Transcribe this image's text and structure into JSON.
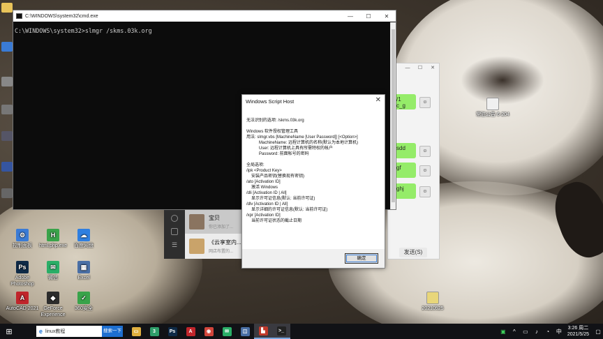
{
  "cmd": {
    "title": "C:\\WINDOWS\\system32\\cmd.exe",
    "line": "C:\\WINDOWS\\system32>slmgr /skms.03k.org",
    "minimize": "—",
    "maximize": "☐",
    "close": "✕"
  },
  "dialog": {
    "title": "Windows Script Host",
    "close": "✕",
    "lines": [
      "无法识别的选项: /skms.03k.org",
      "Windows 软件授权管理工具",
      "用法: slmgr.vbs [MachineName [User Password]] [<Option>]",
      "MachineName: 远程计算机的名称(默认为本地计算机)",
      "User: 远程计算机上具有所需特权的帐户",
      "Password: 前面帐号的密码",
      "全局选项:",
      "/ipk <Product Key>",
      "安装产品密钥(替换现有密钥)",
      "/ato [Activation ID]",
      "激活 Windows",
      "/dli [Activation ID | All]",
      "显示许可证信息(默认: 当前许可证)",
      "/dlv [Activation ID | All]",
      "显示详细的许可证信息(默认: 当前许可证)",
      "/xpr [Activation ID]",
      "当前许可证状态的截止日期"
    ],
    "ok_label": "确定"
  },
  "chat": {
    "minimize": "—",
    "maximize": "☐",
    "close": "✕",
    "bubbles": [
      "/1\nc_g",
      "sdd",
      "gf",
      "ghj"
    ],
    "send_label": "发送(S)"
  },
  "wechat_list": [
    {
      "name": "宝贝",
      "preview": "你已添加了..."
    },
    {
      "name": "《云享室内...",
      "preview": "网店布置的..."
    }
  ],
  "desktop_icons": [
    {
      "label": "控制面板",
      "color": "#3a7bd5",
      "glyph": "⚙"
    },
    {
      "label": "html.php.exe",
      "color": "#3aa34a",
      "glyph": "H"
    },
    {
      "label": "百度网盘",
      "color": "#2f7fe0",
      "glyph": "☁"
    },
    {
      "label": "Adobe Photoshop",
      "color": "#0e2a47",
      "glyph": "Ps"
    },
    {
      "label": "微信",
      "color": "#2aae67",
      "glyph": "✉"
    },
    {
      "label": "Excel",
      "color": "#4a6fa5",
      "glyph": "▦"
    },
    {
      "label": "AutoCAD 2021",
      "color": "#c0252b",
      "glyph": "A"
    },
    {
      "label": "GeForce Experience",
      "color": "#2c2c2c",
      "glyph": "◆"
    },
    {
      "label": "360安全",
      "color": "#39a34a",
      "glyph": "✓"
    }
  ],
  "right_icons": [
    {
      "label": "常驻公告 6-204",
      "color": "#f0f0f0"
    },
    {
      "label": "20210525",
      "color": "#e8d67a"
    }
  ],
  "taskbar": {
    "start": "⊞",
    "search_text": "linux教程",
    "search_button": "搜索一下",
    "apps": [
      {
        "glyph": "▭",
        "color": "#e0b040"
      },
      {
        "glyph": "3",
        "color": "#2e9e6a"
      },
      {
        "glyph": "Ps",
        "color": "#0e2a47"
      },
      {
        "glyph": "A",
        "color": "#c0252b"
      },
      {
        "glyph": "◉",
        "color": "#d2453b"
      },
      {
        "glyph": "✉",
        "color": "#2aae67"
      },
      {
        "glyph": "◫",
        "color": "#4a6fa5"
      },
      {
        "glyph": "▙",
        "color": "#c0392b"
      },
      {
        "glyph": ">_",
        "color": "#222222"
      }
    ],
    "time": "3:26 周二",
    "date": "2021/5/25",
    "notif": "▢"
  }
}
